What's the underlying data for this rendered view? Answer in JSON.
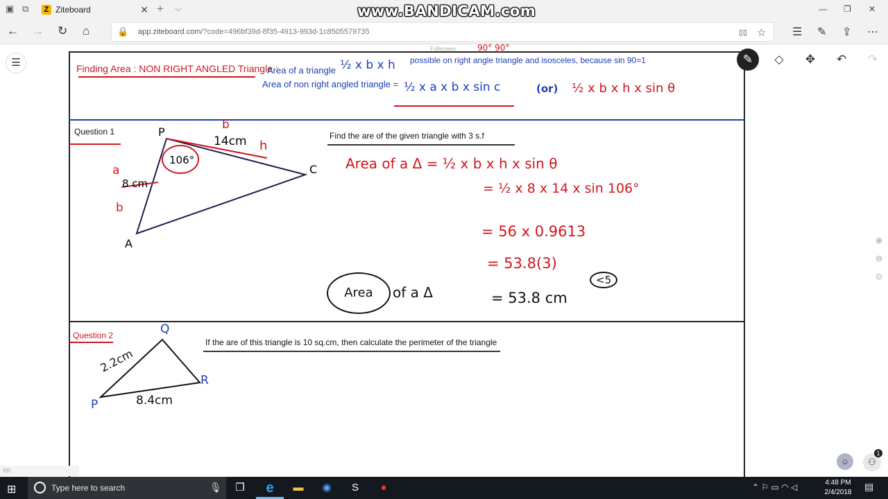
{
  "browser": {
    "tab_title": "Ziteboard",
    "tab_logo": "Z",
    "url_host": "app.ziteboard.com",
    "url_rest": "/?code=496bf39d-8f35-4913-993d-1c8505579735",
    "watermark": "www.BANDICAM.com",
    "close_glyph": "✕",
    "new_tab_glyph": "+",
    "more_tabs_glyph": "⌵",
    "win_min": "—",
    "win_restore": "❐",
    "win_close": "✕",
    "icons": {
      "back": "←",
      "forward": "→",
      "refresh": "↻",
      "home": "⌂",
      "lock": "🔒",
      "reading": "▯▯",
      "favorite": "☆",
      "hub": "☰",
      "notes": "✎",
      "share": "⇪",
      "more": "⋯"
    }
  },
  "board": {
    "fullscreen_label": "Fullscreen",
    "menu_glyph": "☰",
    "toolbar": {
      "pen": "✎",
      "eraser": "◇",
      "move": "✥",
      "undo": "↶",
      "redo": "↷"
    },
    "zoom": {
      "in": "⊕",
      "fit": "⊖",
      "out": "⊙"
    },
    "header": {
      "title": "Finding Area : NON RIGHT ANGLED Triangle :",
      "area_label": "Area of a triangle",
      "area_formula": "½ x b x h",
      "note": "possible on right angle triangle and isosceles, because sin 90=1",
      "note_marks": "90°    90°",
      "nonright_label": "Area of non right angled triangle =",
      "nonright_formula": "½ x a x b x sin c",
      "or_label": "(or)",
      "alt_formula": "½ x b x h x sin θ"
    },
    "q1": {
      "label": "Question 1",
      "prompt": "Find the are of the given triangle with 3 s.f",
      "vertex_p": "P",
      "vertex_a": "A",
      "vertex_c": "C",
      "side_pc": "14cm",
      "side_pa": "8 cm",
      "angle": "106°",
      "mark_a": "a",
      "mark_b1": "b",
      "mark_b2": "b",
      "mark_h": "h",
      "steps": [
        "Area of a Δ = ½ x b x h x sin θ",
        "= ½ x 8 x 14 x sin 106°",
        "= 56 x 0.9613",
        "= 53.8(3)",
        "= 53.8 cm"
      ],
      "circled": "Area",
      "circled_rest": "of a Δ",
      "rounding_mark": "<5"
    },
    "q2": {
      "label": "Question 2",
      "prompt": "If the are of this triangle is 10 sq.cm, then calculate the perimeter of the triangle",
      "vertex_p": "P",
      "vertex_q": "Q",
      "vertex_r": "R",
      "side_pq": "2.2cm",
      "side_pr": "8.4cm"
    },
    "footer_label": "RR"
  },
  "taskbar": {
    "start": "⊞",
    "search_placeholder": "Type here to search",
    "time": "4:48 PM",
    "date": "2/4/2018",
    "apps": [
      "task-view",
      "edge",
      "file-explorer",
      "browser",
      "skype",
      "bandicam"
    ],
    "tray_glyphs": "⌃  ⚐  ▭  ◠  ◁",
    "notification_glyph": "▤",
    "people_badge": "1"
  }
}
